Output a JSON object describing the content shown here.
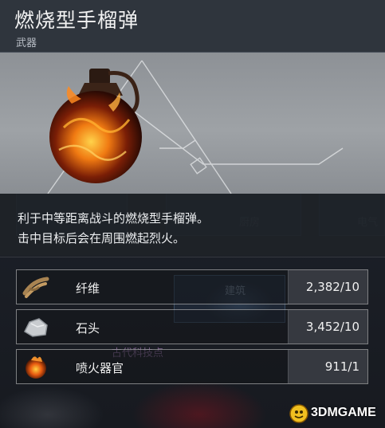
{
  "item": {
    "title": "燃烧型手榴弹",
    "category": "武器",
    "description_lines": [
      "利于中等距离战斗的燃烧型手榴弹。",
      "击中目标后会在周围燃起烈火。"
    ]
  },
  "requirements": [
    {
      "name": "纤维",
      "amount": "2,382/10",
      "icon": "fiber-icon"
    },
    {
      "name": "石头",
      "amount": "3,452/10",
      "icon": "stone-icon"
    },
    {
      "name": "喷火器官",
      "amount": "911/1",
      "icon": "fire-organ-icon"
    }
  ],
  "background": {
    "labels": [
      "厨房",
      "电气",
      "建筑",
      "古代科技点"
    ]
  },
  "watermark": "3DMGAME"
}
